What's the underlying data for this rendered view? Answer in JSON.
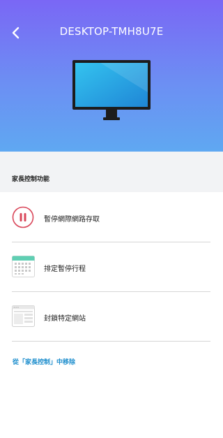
{
  "header": {
    "title": "DESKTOP-TMH8U7E",
    "back_icon": "chevron-left-icon",
    "device_icon": "monitor-icon"
  },
  "section": {
    "title": "家長控制功能"
  },
  "items": [
    {
      "label": "暫停網際網路存取",
      "icon": "pause-icon",
      "accent": "#d9475a"
    },
    {
      "label": "排定暫停行程",
      "icon": "calendar-icon",
      "accent": "#5fcfb3"
    },
    {
      "label": "封鎖特定網站",
      "icon": "browser-window-icon",
      "accent": "#cfcfcf"
    }
  ],
  "footer": {
    "remove_link": "從「家長控制」中移除",
    "link_color": "#1a8ccc"
  }
}
